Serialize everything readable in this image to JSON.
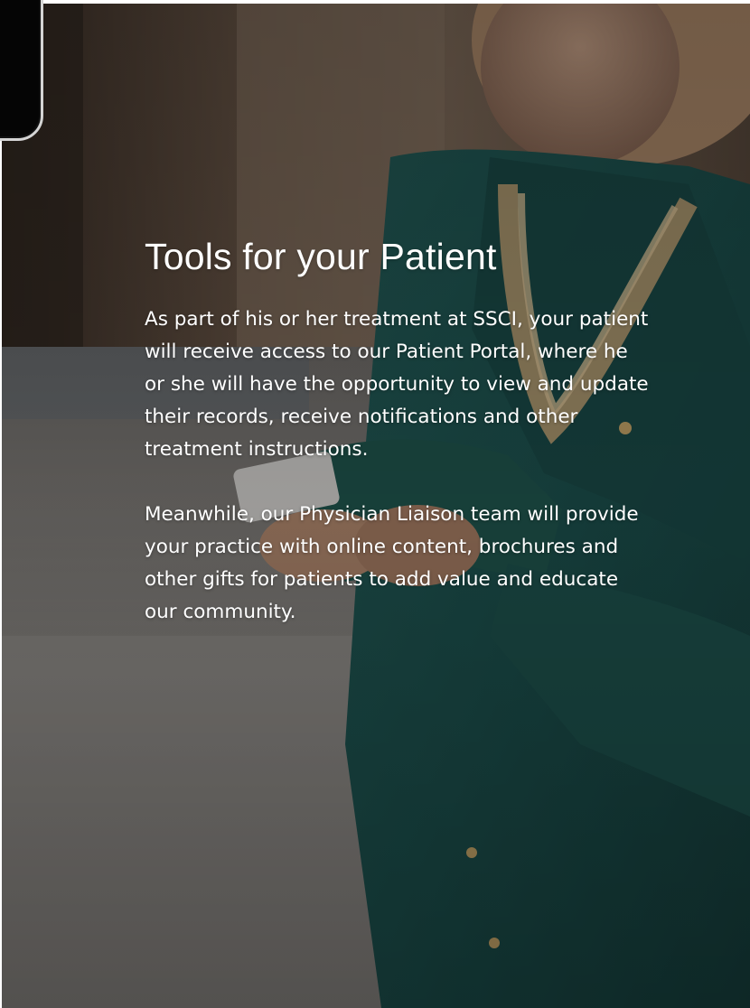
{
  "page": {
    "heading": "Tools for your Patient",
    "paragraphs": [
      "As part of his or her treatment at SSCI, your patient will receive access to our Patient Portal, where he or she will have the opportunity to view and update their records, receive notifications and other treatment instructions.",
      "Meanwhile, our Physician Liaison team will provide your practice with online content, brochures and other gifts for patients to add value and educate our community."
    ]
  },
  "colors": {
    "text": "#ffffff",
    "overlay": "#3f3a34",
    "blouse": "#1f5f5c"
  },
  "background": {
    "icon": "woman-using-phone-photo"
  }
}
